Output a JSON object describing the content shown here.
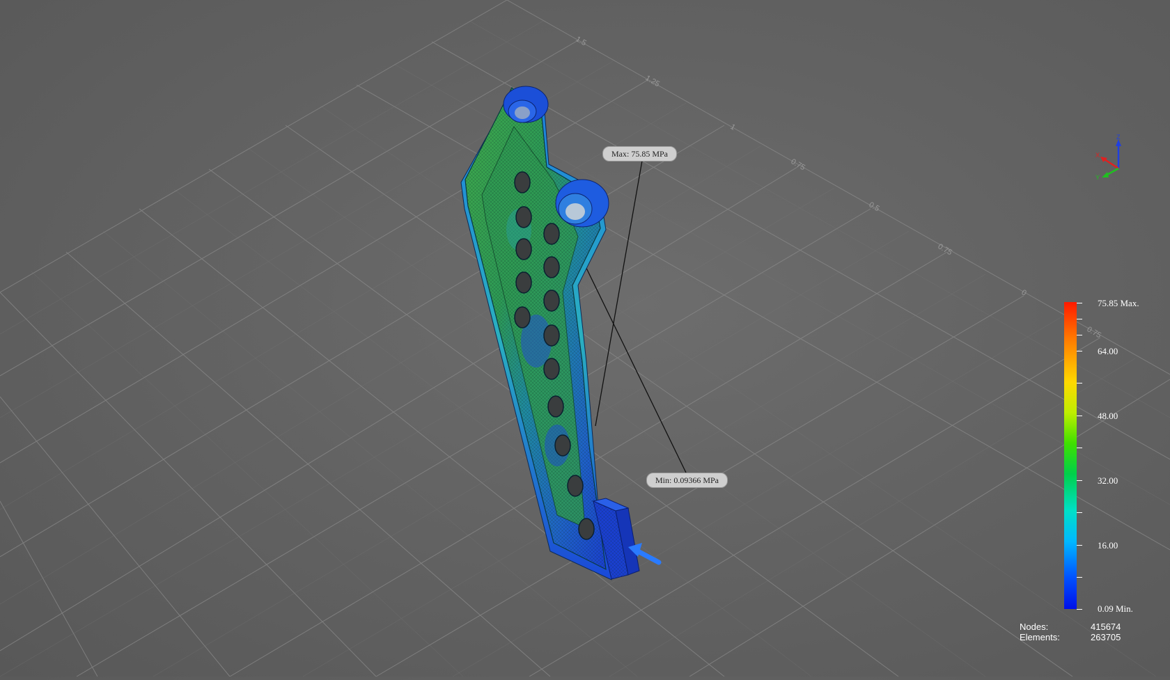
{
  "result_labels": {
    "max": "Max: 75.85 MPa",
    "min": "Min: 0.09366 MPa"
  },
  "legend": {
    "max_label": "75.85 Max.",
    "min_label": "0.09 Min.",
    "ticks": [
      "75.85 Max.",
      "64.00",
      "48.00",
      "32.00",
      "16.00",
      "0.09 Min."
    ],
    "colors": [
      "#ff1a00",
      "#ff7a00",
      "#ffd800",
      "#3fe000",
      "#00e0c8",
      "#00b8ff",
      "#0010e8"
    ]
  },
  "stats": {
    "nodes_label": "Nodes:",
    "nodes_value": "415674",
    "elements_label": "Elements:",
    "elements_value": "263705"
  },
  "grid_labels": [
    "1.5",
    "1.25",
    "1",
    "0.75",
    "0.5",
    "0.75",
    "0",
    "0.75"
  ],
  "triad": {
    "x_label": "X",
    "y_label": "Y",
    "z_label": "Z",
    "x_color": "#e02020",
    "y_color": "#20c020",
    "z_color": "#2040e0"
  },
  "background_color": "#636363"
}
